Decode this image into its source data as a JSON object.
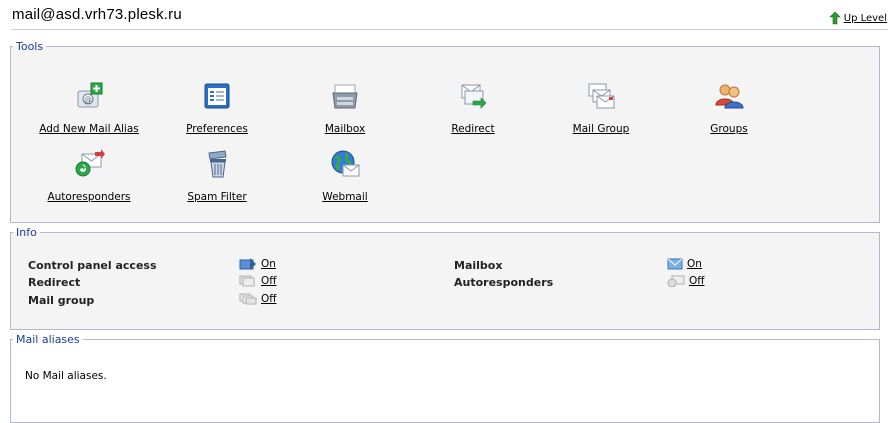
{
  "header": {
    "title": "mail@asd.vrh73.plesk.ru",
    "up_level": "Up Level"
  },
  "tools": {
    "legend": "Tools",
    "items": [
      {
        "label": "Add New Mail Alias",
        "icon": "add-mail-alias-icon"
      },
      {
        "label": "Preferences",
        "icon": "preferences-icon"
      },
      {
        "label": "Mailbox",
        "icon": "mailbox-icon"
      },
      {
        "label": "Redirect",
        "icon": "redirect-icon"
      },
      {
        "label": "Mail Group",
        "icon": "mail-group-icon"
      },
      {
        "label": "Groups",
        "icon": "groups-icon"
      },
      {
        "label": "Autoresponders",
        "icon": "autoresponders-icon"
      },
      {
        "label": "Spam Filter",
        "icon": "spam-filter-icon"
      },
      {
        "label": "Webmail",
        "icon": "webmail-icon"
      }
    ]
  },
  "info": {
    "legend": "Info",
    "rows": [
      {
        "label": "Control panel access",
        "value": "On"
      },
      {
        "label": "Mailbox",
        "value": "On"
      },
      {
        "label": "Redirect",
        "value": "Off"
      },
      {
        "label": "Autoresponders",
        "value": "Off"
      },
      {
        "label": "Mail group",
        "value": "Off"
      }
    ]
  },
  "aliases": {
    "legend": "Mail aliases",
    "empty": "No Mail aliases."
  },
  "colors": {
    "legend_text": "#1a3e95",
    "panel_bg": "#f4f4f4",
    "border": "#b5b8c8",
    "up_arrow": "#2e9a2e"
  }
}
